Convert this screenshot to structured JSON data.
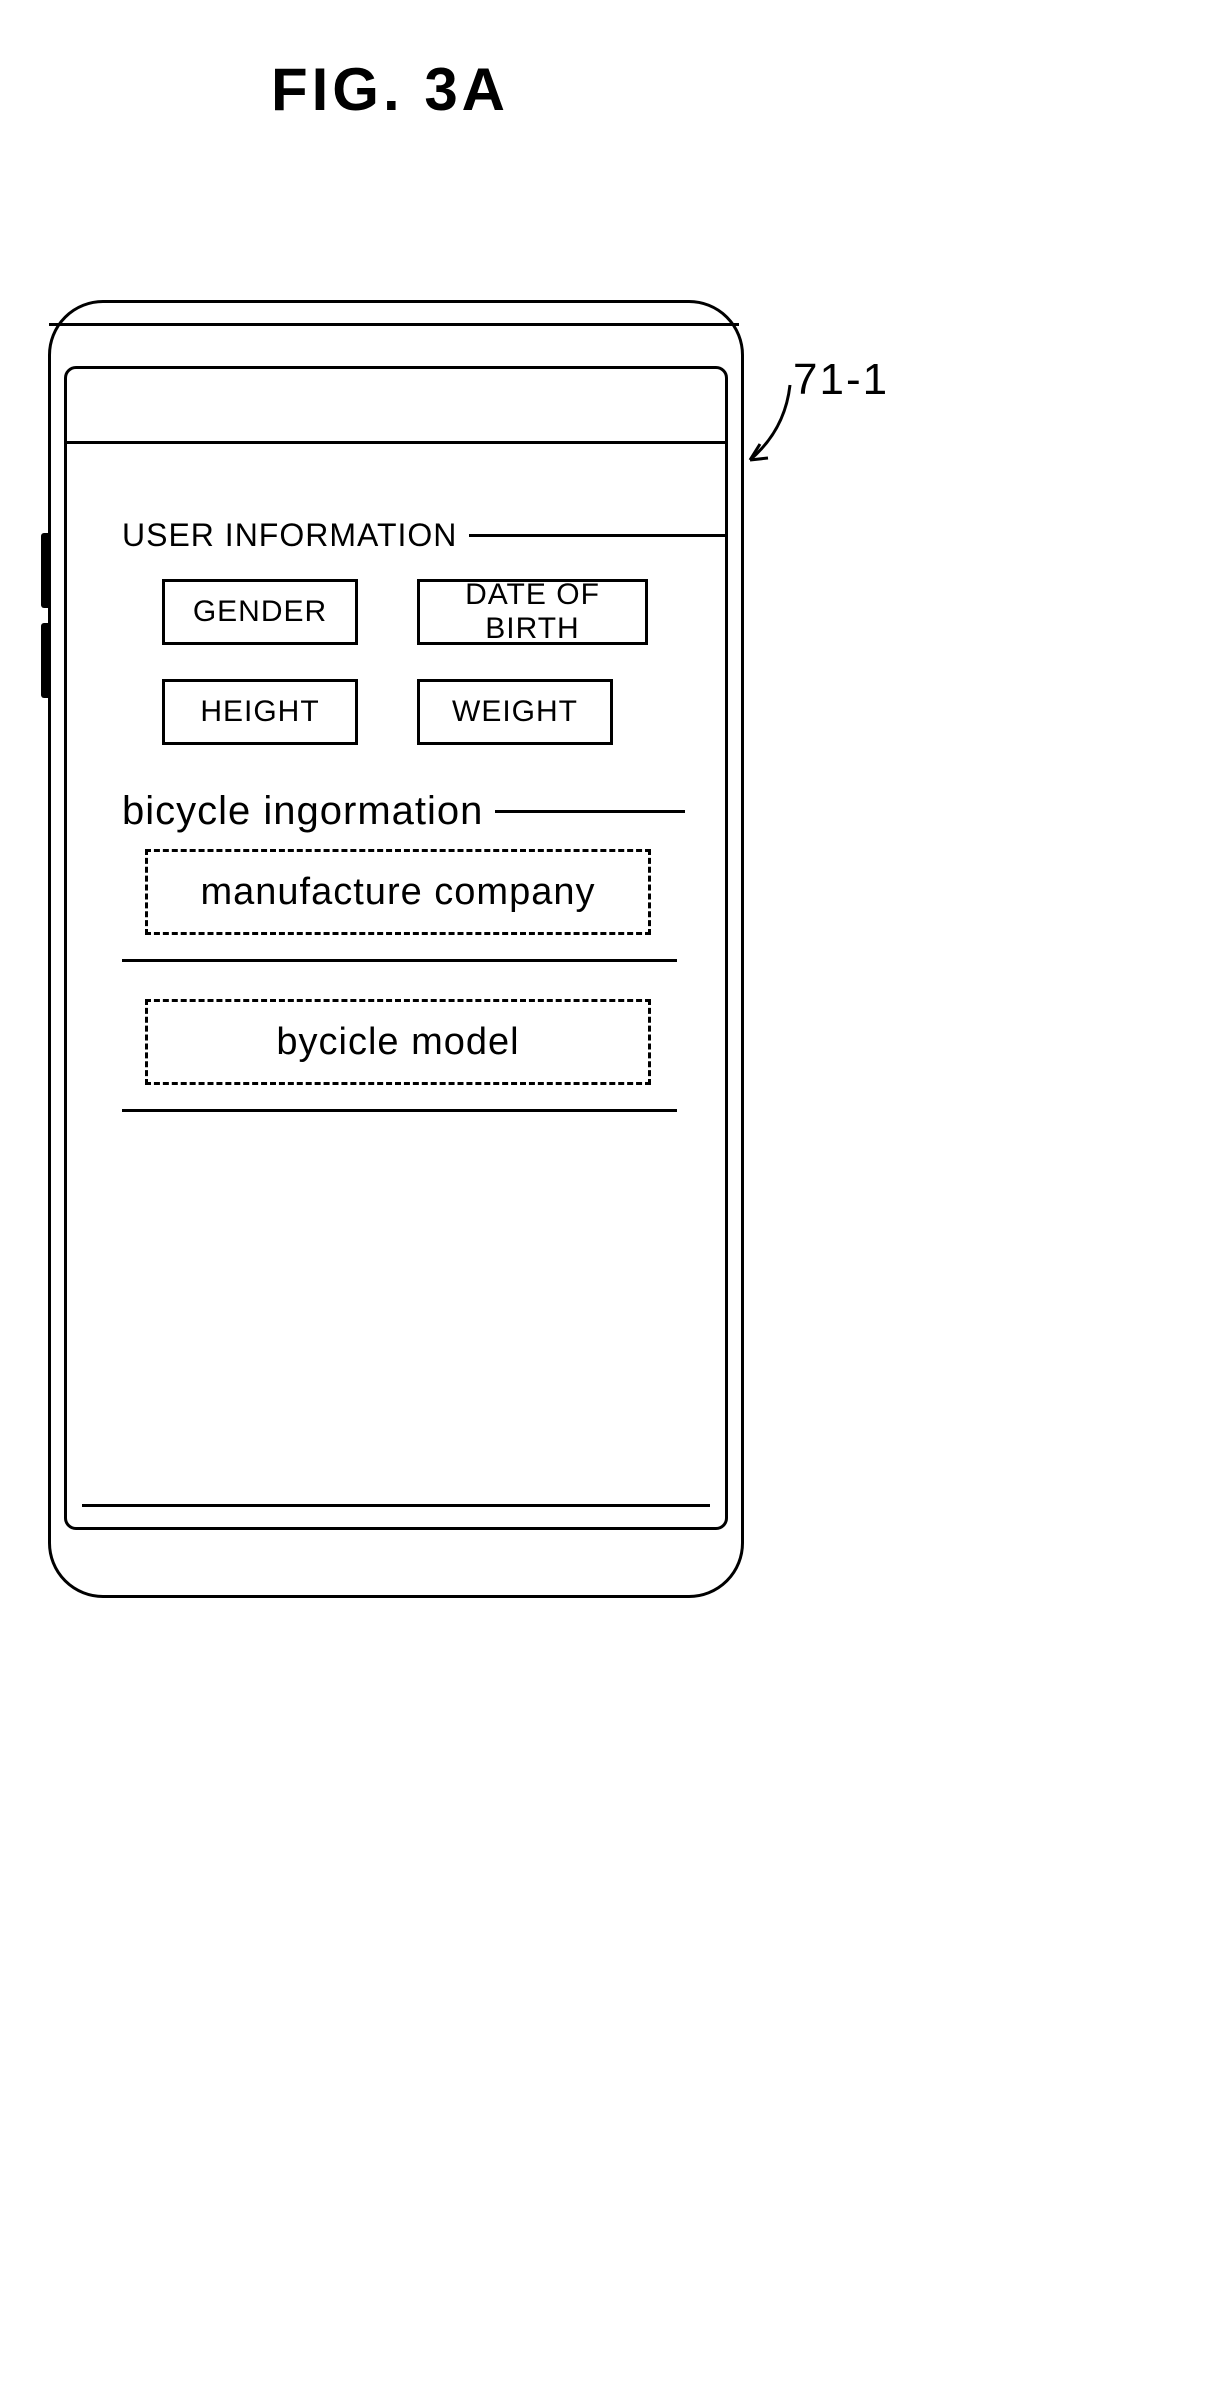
{
  "figure": {
    "title": "FIG. 3A",
    "callout_label": "71-1"
  },
  "sections": {
    "user_info": {
      "label": "USER INFORMATION",
      "fields": {
        "gender": "GENDER",
        "dob": "DATE OF BIRTH",
        "height": "HEIGHT",
        "weight": "WEIGHT"
      }
    },
    "bike_info": {
      "label": "bicycle ingormation",
      "fields": {
        "manufacturer": "manufacture company",
        "model": "bycicle model"
      }
    }
  }
}
